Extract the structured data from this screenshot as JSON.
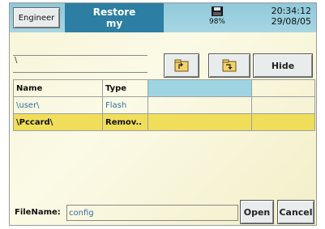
{
  "header": {
    "engineer_label": "Engineer",
    "title_line1": "Restore",
    "title_line2": "my",
    "storage_percent": "98%",
    "time": "20:34:12",
    "date": "29/08/05"
  },
  "path": {
    "value": "\\"
  },
  "toolbar": {
    "up_icon": "folder-up-icon",
    "new_icon": "folder-new-icon",
    "hide_label": "Hide"
  },
  "table": {
    "columns": [
      "Name",
      "Type"
    ],
    "rows": [
      {
        "name": "\\user\\",
        "type": "Flash"
      },
      {
        "name": "\\Pccard\\",
        "type": "Remov.."
      }
    ]
  },
  "footer": {
    "filename_label": "FileName:",
    "filename_value": "config",
    "open_label": "Open",
    "cancel_label": "Cancel"
  },
  "colors": {
    "header_bg": "#8fc9da",
    "title_bg": "#2c7ea3",
    "selected_row": "#f0dd5a",
    "link_blue": "#2f6fa8"
  }
}
